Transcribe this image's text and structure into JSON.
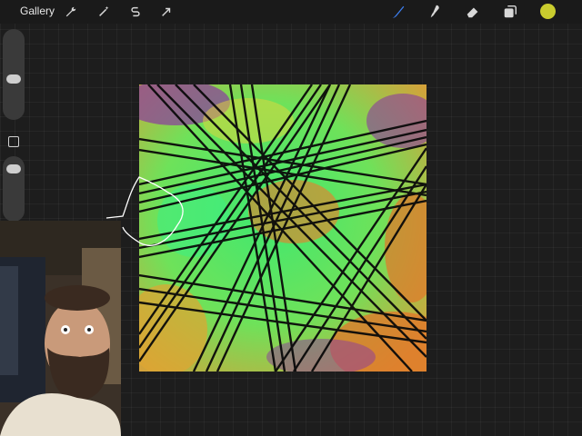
{
  "toolbar": {
    "gallery_label": "Gallery",
    "left_tools": [
      {
        "name": "actions",
        "icon": "wrench-icon"
      },
      {
        "name": "adjustments",
        "icon": "magic-wand-icon"
      },
      {
        "name": "selection",
        "icon": "selection-s-icon"
      },
      {
        "name": "transform",
        "icon": "arrow-cursor-icon"
      }
    ],
    "right_tools": [
      {
        "name": "brush",
        "icon": "brush-icon",
        "active": true
      },
      {
        "name": "smudge",
        "icon": "smudge-icon"
      },
      {
        "name": "eraser",
        "icon": "eraser-icon"
      },
      {
        "name": "layers",
        "icon": "layers-icon"
      }
    ],
    "current_color": "#c9cc2e",
    "active_tool_color": "#3d7ff0"
  },
  "sidebar": {
    "brush_size_level": 0.45,
    "opacity_level": 0.85
  },
  "artwork": {
    "description_colors": [
      "#3ee86b",
      "#f07a28",
      "#7a3a9a",
      "#d8d23a"
    ]
  }
}
